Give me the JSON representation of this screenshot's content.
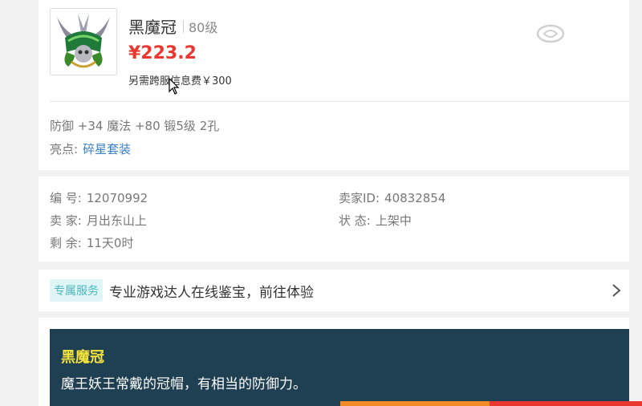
{
  "item": {
    "name": "黑魔冠",
    "level": "80级",
    "price": "¥223.2",
    "fee": "另需跨服信息费￥300",
    "attributes": "防御 +34 魔法 +80 锻5级 2孔",
    "highlight_label": "亮点:",
    "highlight_value": "碎星套装"
  },
  "details": {
    "id_label": "编 号:",
    "id_value": "12070992",
    "seller_id_label": "卖家ID:",
    "seller_id_value": "40832854",
    "seller_label": "卖 家:",
    "seller_value": "月出东山上",
    "status_label": "状 态:",
    "status_value": "上架中",
    "remaining_label": "剩 余:",
    "remaining_value": "11天0时"
  },
  "service": {
    "tag": "专属服务",
    "text": "专业游戏达人在线鉴宝，前往体验"
  },
  "description": {
    "name": "黑魔冠",
    "text": "魔王妖王常戴的冠帽，有相当的防御力。"
  },
  "colors": {
    "price": "#e8382f",
    "link": "#3b7fc4",
    "desc_bg": "#1f3f52",
    "desc_title": "#f5e23a"
  }
}
